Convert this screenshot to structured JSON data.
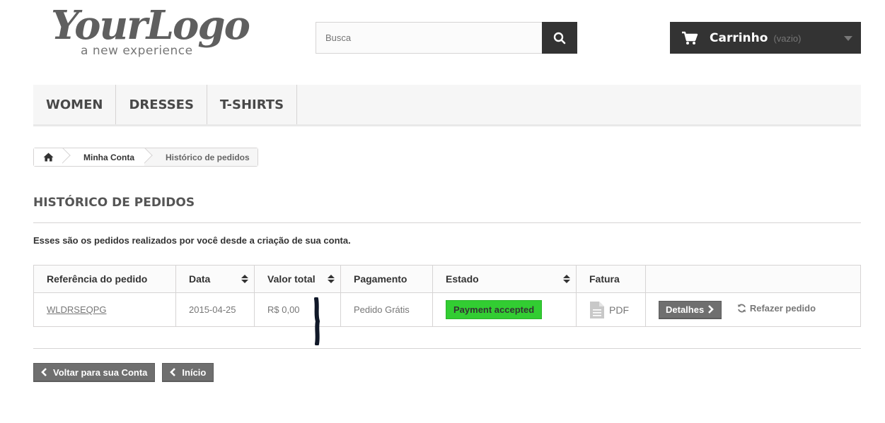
{
  "logo": {
    "script": "YourLogo",
    "tagline": "a new experience"
  },
  "search": {
    "placeholder": "Busca"
  },
  "cart": {
    "label": "Carrinho",
    "empty": "(vazio)"
  },
  "menu": {
    "items": [
      {
        "label": "WOMEN"
      },
      {
        "label": "DRESSES"
      },
      {
        "label": "T-SHIRTS"
      }
    ]
  },
  "breadcrumb": {
    "account": "Minha Conta",
    "current": "Histórico de pedidos"
  },
  "page": {
    "heading": "HISTÓRICO DE PEDIDOS",
    "intro": "Esses são os pedidos realizados por você desde a criação de sua conta."
  },
  "table": {
    "headers": {
      "reference": "Referência do pedido",
      "date": "Data",
      "total": "Valor total",
      "payment": "Pagamento",
      "status": "Estado",
      "invoice": "Fatura"
    },
    "rows": [
      {
        "reference": "WLDRSEQPG",
        "date": "2015-04-25",
        "total": "R$ 0,00",
        "payment": "Pedido Grátis",
        "status": "Payment accepted",
        "invoice": "PDF",
        "details": "Detalhes",
        "reorder": "Refazer pedido"
      }
    ]
  },
  "footer": {
    "back_account": "Voltar para sua Conta",
    "home": "Início"
  },
  "colors": {
    "dark": "#333333",
    "status_green": "#32cd32",
    "button_grey": "#6f6f6f"
  }
}
